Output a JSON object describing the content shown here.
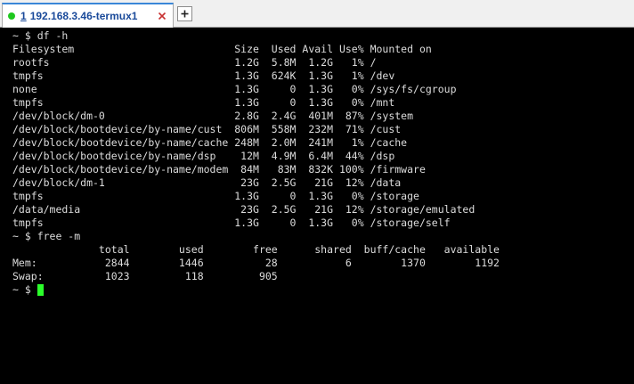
{
  "tab": {
    "index": "1",
    "title": "192.168.3.46-termux1",
    "status_color": "#1ec81e"
  },
  "icons": {
    "close": "close-icon",
    "new_tab": "plus-icon",
    "status": "connection-status-icon"
  },
  "terminal": {
    "lines": [
      "~ $ df -h",
      "Filesystem                          Size  Used Avail Use% Mounted on",
      "rootfs                              1.2G  5.8M  1.2G   1% /",
      "tmpfs                               1.3G  624K  1.3G   1% /dev",
      "none                                1.3G     0  1.3G   0% /sys/fs/cgroup",
      "tmpfs                               1.3G     0  1.3G   0% /mnt",
      "/dev/block/dm-0                     2.8G  2.4G  401M  87% /system",
      "/dev/block/bootdevice/by-name/cust  806M  558M  232M  71% /cust",
      "/dev/block/bootdevice/by-name/cache 248M  2.0M  241M   1% /cache",
      "/dev/block/bootdevice/by-name/dsp    12M  4.9M  6.4M  44% /dsp",
      "/dev/block/bootdevice/by-name/modem  84M   83M  832K 100% /firmware",
      "/dev/block/dm-1                      23G  2.5G   21G  12% /data",
      "tmpfs                               1.3G     0  1.3G   0% /storage",
      "/data/media                          23G  2.5G   21G  12% /storage/emulated",
      "tmpfs                               1.3G     0  1.3G   0% /storage/self",
      "~ $ free -m",
      "              total        used        free      shared  buff/cache   available",
      "Mem:           2844        1446          28           6        1370        1192",
      "Swap:          1023         118         905"
    ],
    "prompt": "~ $ ",
    "cursor_color": "#2bff2b"
  }
}
